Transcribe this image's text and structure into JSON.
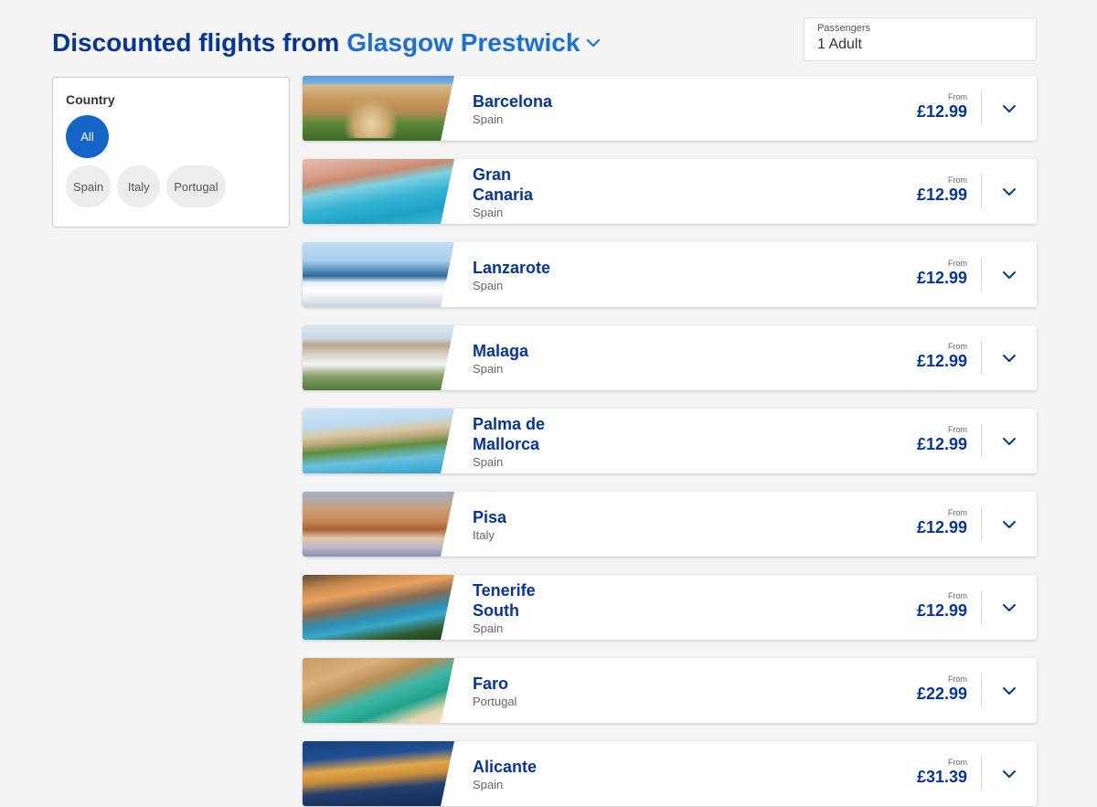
{
  "header": {
    "title_prefix": "Discounted flights from",
    "airport": "Glasgow Prestwick"
  },
  "passengers": {
    "label": "Passengers",
    "value": "1 Adult"
  },
  "filter": {
    "title": "Country",
    "all_label": "All",
    "chips": [
      "Spain",
      "Italy",
      "Portugal"
    ]
  },
  "destinations": [
    {
      "city": "Barcelona",
      "country": "Spain",
      "from": "From",
      "price": "£12.99"
    },
    {
      "city": "Gran Canaria",
      "country": "Spain",
      "from": "From",
      "price": "£12.99"
    },
    {
      "city": "Lanzarote",
      "country": "Spain",
      "from": "From",
      "price": "£12.99"
    },
    {
      "city": "Malaga",
      "country": "Spain",
      "from": "From",
      "price": "£12.99"
    },
    {
      "city": "Palma de Mallorca",
      "country": "Spain",
      "from": "From",
      "price": "£12.99"
    },
    {
      "city": "Pisa",
      "country": "Italy",
      "from": "From",
      "price": "£12.99"
    },
    {
      "city": "Tenerife South",
      "country": "Spain",
      "from": "From",
      "price": "£12.99"
    },
    {
      "city": "Faro",
      "country": "Portugal",
      "from": "From",
      "price": "£22.99"
    },
    {
      "city": "Alicante",
      "country": "Spain",
      "from": "From",
      "price": "£31.39"
    }
  ],
  "colors": {
    "brand_navy": "#073590",
    "accent_blue": "#1565c9",
    "background": "#f4f4f4"
  }
}
